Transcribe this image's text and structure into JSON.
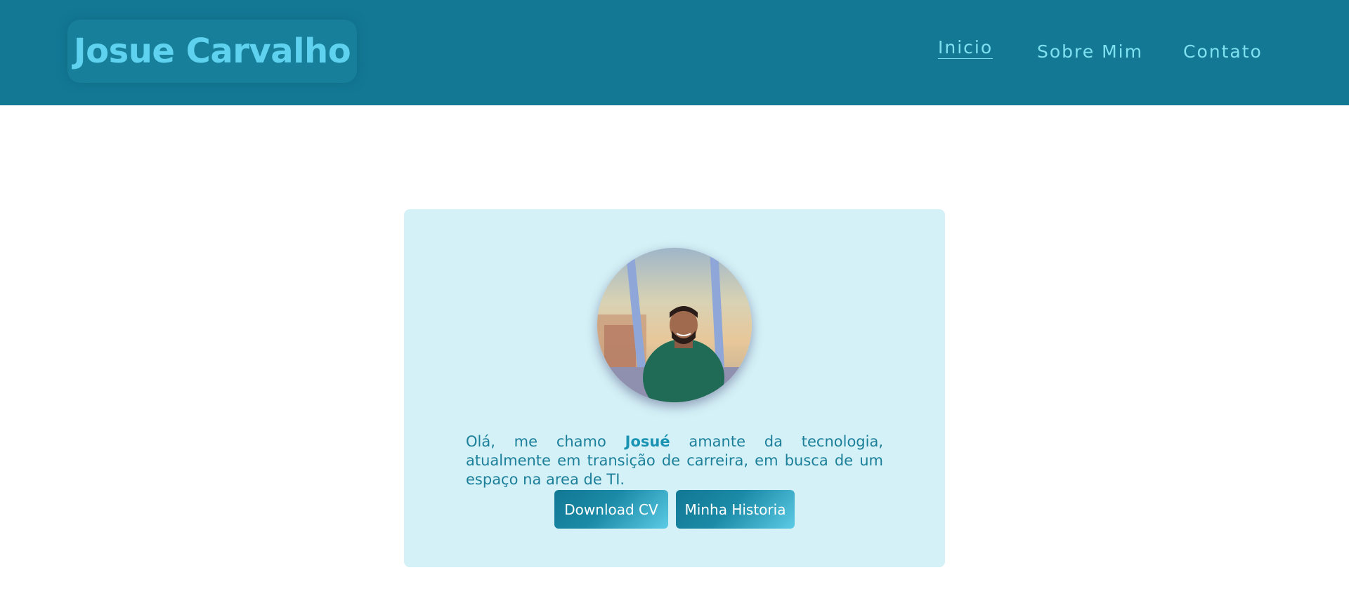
{
  "header": {
    "logo_text": "Josue Carvalho",
    "nav": [
      {
        "label": "Inicio",
        "active": true
      },
      {
        "label": "Sobre Mim",
        "active": false
      },
      {
        "label": "Contato",
        "active": false
      }
    ]
  },
  "hero": {
    "intro_before": "Olá, me chamo ",
    "intro_name": "Josué",
    "intro_after": " amante da tecnologia, atualmente em transição de carreira, em busca de um espaço na area de TI.",
    "buttons": {
      "download_cv": "Download CV",
      "my_story": "Minha Historia"
    }
  },
  "colors": {
    "header_bg": "#127894",
    "logo_text": "#5ed2ee",
    "nav_text": "#7fe0f0",
    "card_bg": "#d4f1f7",
    "intro_text": "#1c7f99",
    "button_gradient_start": "#127894",
    "button_gradient_end": "#5ccbe6"
  }
}
